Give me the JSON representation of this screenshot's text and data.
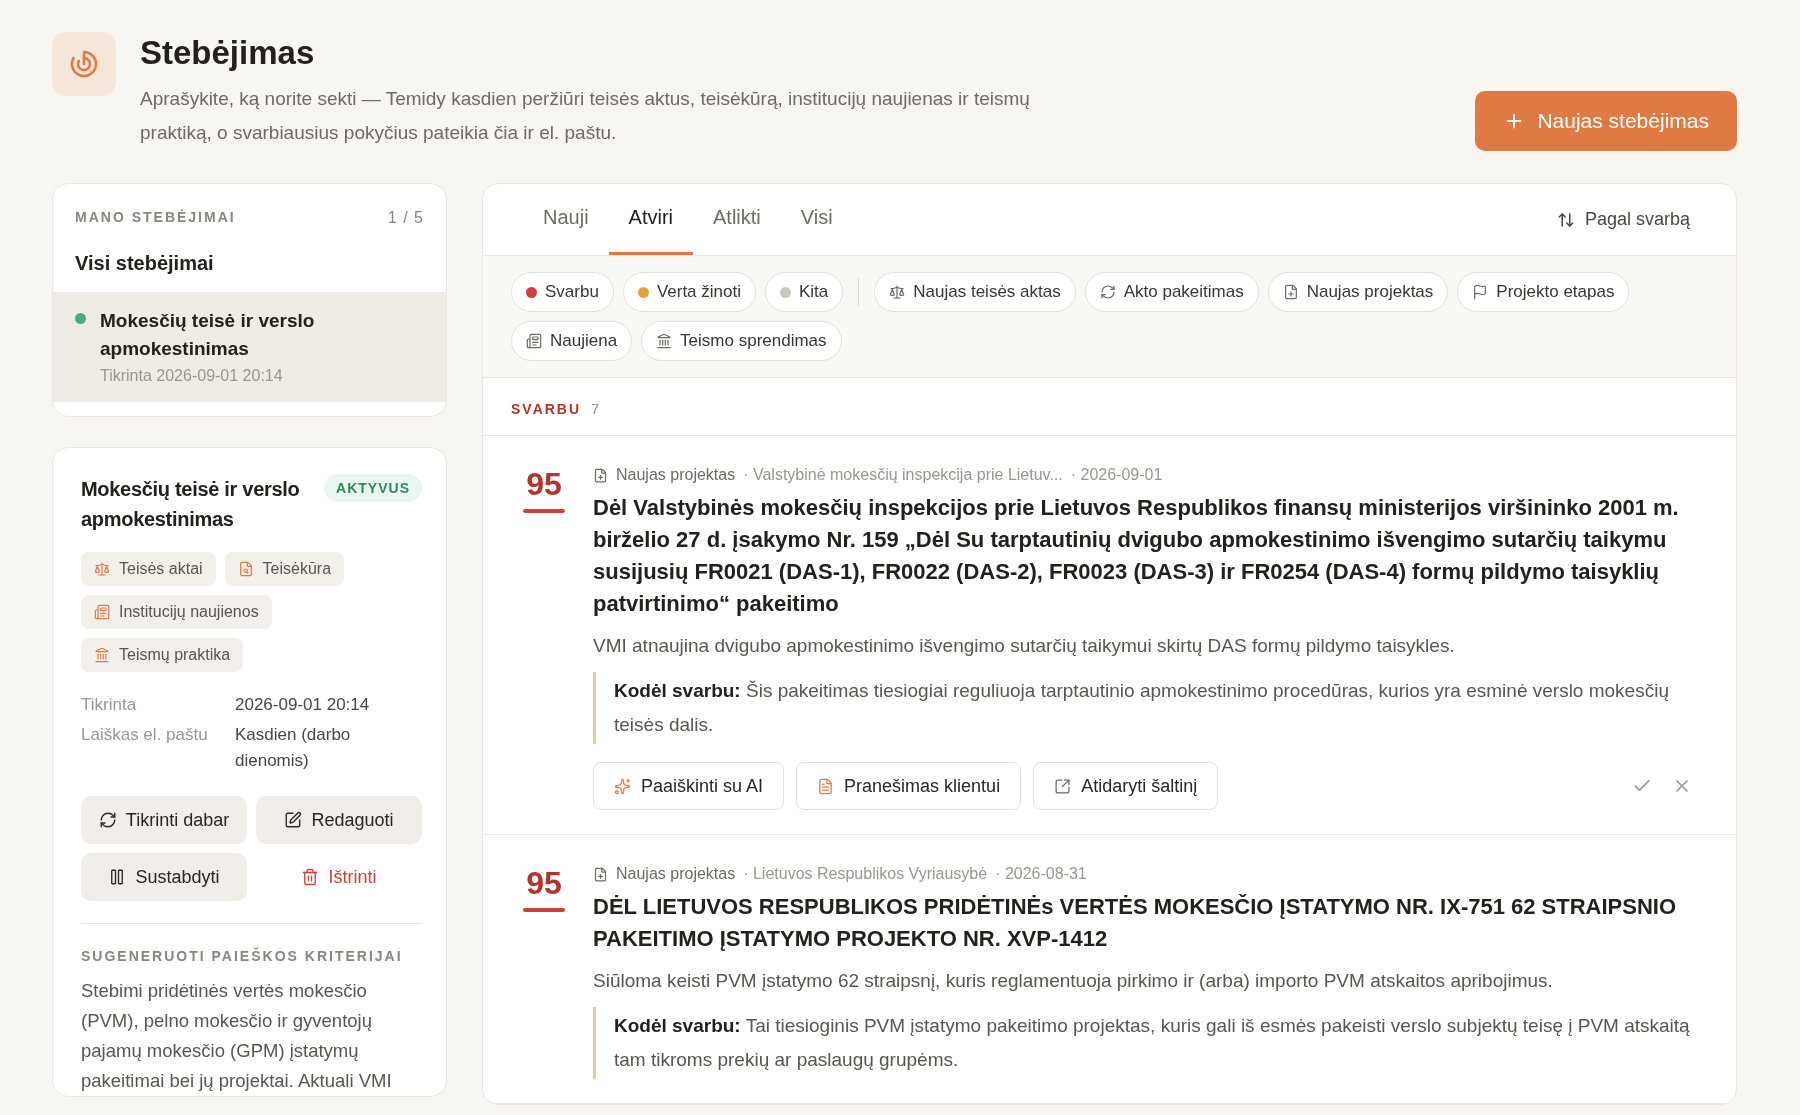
{
  "header": {
    "title": "Stebėjimas",
    "description": "Aprašykite, ką norite sekti — Temidy kasdien peržiūri teisės aktus, teisėkūrą, institucijų naujienas ir teismų praktiką, o svarbiausius pokyčius pateikia čia ir el. paštu.",
    "new_button": "Naujas stebėjimas"
  },
  "watches": {
    "heading": "MANO STEBĖJIMAI",
    "count": "1 / 5",
    "all_label": "Visi stebėjimai",
    "items": [
      {
        "name": "Mokesčių teisė ir verslo apmokestinimas",
        "checked": "Tikrinta 2026-09-01 20:14",
        "selected": true,
        "color": "#4caf7a"
      }
    ]
  },
  "detail": {
    "title": "Mokesčių teisė ir verslo apmokestinimas",
    "status": "AKTYVUS",
    "sources": [
      {
        "label": "Teisės aktai",
        "kind": "law"
      },
      {
        "label": "Teisėkūra",
        "kind": "drafting"
      },
      {
        "label": "Institucijų naujienos",
        "kind": "news"
      },
      {
        "label": "Teismų praktika",
        "kind": "court"
      }
    ],
    "fields": [
      {
        "label": "Tikrinta",
        "value": "2026-09-01 20:14"
      },
      {
        "label": "Laiškas el. paštu",
        "value": "Kasdien (darbo dienomis)"
      }
    ],
    "buttons": [
      {
        "label": "Tikrinti dabar",
        "kind": "refresh"
      },
      {
        "label": "Redaguoti",
        "kind": "edit"
      },
      {
        "label": "Sustabdyti",
        "kind": "pause"
      },
      {
        "label": "Ištrinti",
        "kind": "delete"
      }
    ],
    "criteria_heading": "SUGENERUOTI PAIEŠKOS KRITERIJAI",
    "criteria_text": "Stebimi pridėtinės vertės mokesčio (PVM), pelno mokesčio ir gyventojų pajamų mokesčio (GPM) įstatymų pakeitimai bei jų projektai. Aktuali VMI"
  },
  "feed": {
    "tabs": [
      {
        "label": "Nauji",
        "selected": false
      },
      {
        "label": "Atviri",
        "selected": true
      },
      {
        "label": "Atlikti",
        "selected": false
      },
      {
        "label": "Visi",
        "selected": false
      }
    ],
    "sort": "Pagal svarbą",
    "filters": [
      {
        "label": "Svarbu",
        "kind": "dot",
        "color": "#d0413a"
      },
      {
        "label": "Verta žinoti",
        "kind": "dot",
        "color": "#e8a03a"
      },
      {
        "label": "Kita",
        "kind": "dot",
        "color": "#c9c6c0"
      },
      {
        "label": "Naujas teisės aktas",
        "kind": "law"
      },
      {
        "label": "Akto pakeitimas",
        "kind": "change"
      },
      {
        "label": "Naujas projektas",
        "kind": "project"
      },
      {
        "label": "Projekto etapas",
        "kind": "stage"
      },
      {
        "label": "Naujiena",
        "kind": "news"
      },
      {
        "label": "Teismo sprendimas",
        "kind": "court"
      }
    ],
    "section": {
      "label": "SVARBU",
      "count": "7"
    },
    "items": [
      {
        "score": "95",
        "type": "Naujas projektas",
        "source": "· Valstybinė mokesčių inspekcija prie Lietuv...",
        "date": "· 2026-09-01",
        "title": "Dėl Valstybinės mokesčių inspekcijos prie Lietuvos Respublikos finansų ministerijos viršininko 2001 m. birželio 27 d. įsakymo Nr. 159 „Dėl Su tarptautinių dvigubo apmokestinimo išvengimo sutarčių taikymu susijusių FR0021 (DAS-1), FR0022 (DAS-2), FR0023 (DAS-3) ir FR0254 (DAS-4) formų pildymo taisyklių patvirtinimo“ pakeitimo",
        "summary": "VMI atnaujina dvigubo apmokestinimo išvengimo sutarčių taikymui skirtų DAS formų pildymo taisykles.",
        "why": "**Kodėl svarbu:** Šis pakeitimas tiesiogiai reguliuoja tarptautinio apmokestinimo procedūras, kurios yra esminė verslo mokesčių teisės dalis.",
        "actions": [
          {
            "label": "Paaiškinti su AI",
            "kind": "ai"
          },
          {
            "label": "Pranešimas klientui",
            "kind": "note"
          },
          {
            "label": "Atidaryti šaltinį",
            "kind": "open"
          }
        ]
      },
      {
        "score": "95",
        "type": "Naujas projektas",
        "source": "· Lietuvos Respublikos Vyriausybė",
        "date": "· 2026-08-31",
        "title": "DĖL LIETUVOS RESPUBLIKOS PRIDĖTINĖs VERTĖS MOKESČIO ĮSTATYMO NR. IX-751 62 STRAIPSNIO PAKEITIMO ĮSTATYMO PROJEKTO NR. XVP-1412",
        "summary": "Siūloma keisti PVM įstatymo 62 straipsnį, kuris reglamentuoja pirkimo ir (arba) importo PVM atskaitos apribojimus.",
        "why": "**Kodėl svarbu:** Tai tiesioginis PVM įstatymo pakeitimo projektas, kuris gali iš esmės pakeisti verslo subjektų teisę į PVM atskaitą tam tikroms prekių ar paslaugų grupėms."
      }
    ]
  }
}
